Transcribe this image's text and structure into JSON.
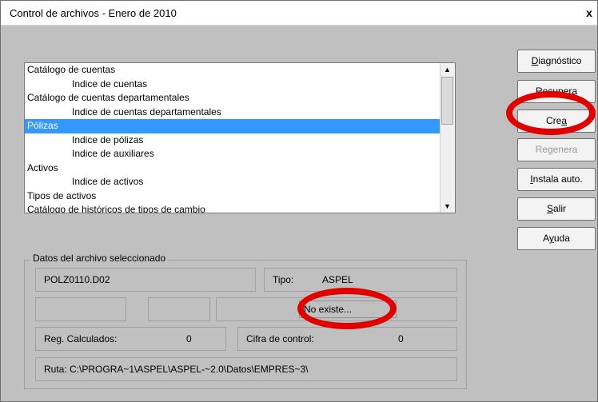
{
  "window": {
    "title": "Control de archivos - Enero de 2010",
    "close_glyph": "x"
  },
  "file_list": {
    "items": [
      {
        "label": "Catálogo de cuentas",
        "indent": false,
        "selected": false
      },
      {
        "label": "Indice de cuentas",
        "indent": true,
        "selected": false
      },
      {
        "label": "Catálogo de cuentas departamentales",
        "indent": false,
        "selected": false
      },
      {
        "label": "Indice de cuentas departamentales",
        "indent": true,
        "selected": false
      },
      {
        "label": "Pólizas",
        "indent": false,
        "selected": true
      },
      {
        "label": "Indice de pólizas",
        "indent": true,
        "selected": false
      },
      {
        "label": "Indice de auxiliares",
        "indent": true,
        "selected": false
      },
      {
        "label": "Activos",
        "indent": false,
        "selected": false
      },
      {
        "label": "Indice de activos",
        "indent": true,
        "selected": false
      },
      {
        "label": "Tipos de activos",
        "indent": false,
        "selected": false
      },
      {
        "label": "Catálogo de históricos de tipos de cambio",
        "indent": false,
        "selected": false
      }
    ]
  },
  "buttons": {
    "diagnostico": {
      "pre": "",
      "u": "D",
      "post": "iagnóstico"
    },
    "recupera": {
      "pre": "",
      "u": "R",
      "post": "ecupera"
    },
    "crea": {
      "pre": "Cre",
      "u": "a",
      "post": ""
    },
    "regenera": {
      "pre": "Re",
      "u": "g",
      "post": "enera"
    },
    "instala": {
      "pre": "",
      "u": "I",
      "post": "nstala auto."
    },
    "salir": {
      "pre": "",
      "u": "S",
      "post": "alir"
    },
    "ayuda": {
      "pre": "A",
      "u": "y",
      "post": "uda"
    }
  },
  "details": {
    "group_title": "Datos del archivo seleccionado",
    "filename": "POLZ0110.D02",
    "tipo_label": "Tipo:",
    "tipo_value": "ASPEL",
    "status": "No existe...",
    "reg_label": "Reg. Calculados:",
    "reg_value": "0",
    "cifra_label": "Cifra de control:",
    "cifra_value": "0",
    "ruta_label": "Ruta:",
    "ruta_value": "C:\\PROGRA~1\\ASPEL\\ASPEL-~2.0\\Datos\\EMPRES~3\\"
  },
  "colors": {
    "selection": "#3399ff",
    "annotation_ring": "#e00000"
  }
}
